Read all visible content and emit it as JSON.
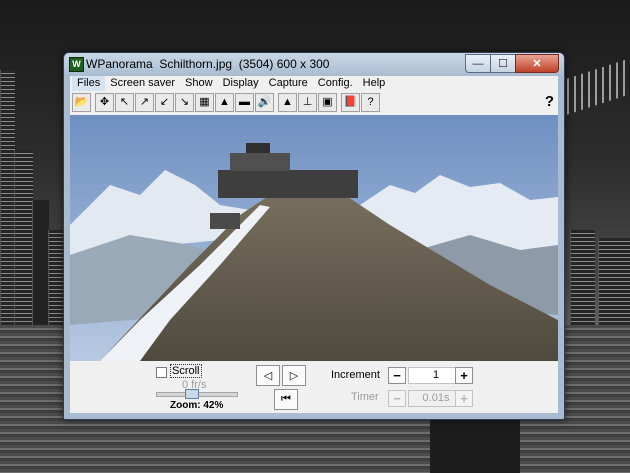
{
  "window": {
    "title": "WPanorama  Schilthorn.jpg  (3504) 600 x 300",
    "app_icon_glyph": "W",
    "minimize_glyph": "—",
    "maximize_glyph": "☐",
    "close_glyph": "✕"
  },
  "menu": [
    "Files",
    "Screen saver",
    "Show",
    "Display",
    "Capture",
    "Config.",
    "Help"
  ],
  "toolbar": {
    "icons": [
      "open-folder-icon",
      "scroll-left-right-icon",
      "scroll-left-up-icon",
      "scroll-right-up-icon",
      "scroll-left-down-icon",
      "scroll-right-down-icon",
      "landscape-fit-icon",
      "landscape-icon",
      "panorama-strip-icon",
      "sound-icon",
      "mountain-dark-icon",
      "tripod-icon",
      "window-fit-icon",
      "book-icon",
      "info-icon"
    ],
    "glyphs": [
      "📂",
      "✥",
      "↖",
      "↗",
      "↙",
      "↘",
      "▦",
      "▲",
      "▬",
      "🔊",
      "▲",
      "⊥",
      "▣",
      "📕",
      "?"
    ],
    "help_glyph": "?"
  },
  "image": {
    "sky_color": "#8fa9d3",
    "mountain_color": "#6d6656",
    "snow_color": "#e6ecf3"
  },
  "controls": {
    "scroll_label": "Scroll",
    "scroll_checked": false,
    "speed_text": "0 fr/s",
    "zoom_text": "Zoom: 42%",
    "zoom_percent": 42,
    "prev_glyph": "◁",
    "next_glyph": "▷",
    "first_glyph": "⏮",
    "increment_label": "Increment",
    "increment_value": "1",
    "minus_glyph": "−",
    "plus_glyph": "+",
    "timer_label": "Timer",
    "timer_value": "0.01s"
  }
}
